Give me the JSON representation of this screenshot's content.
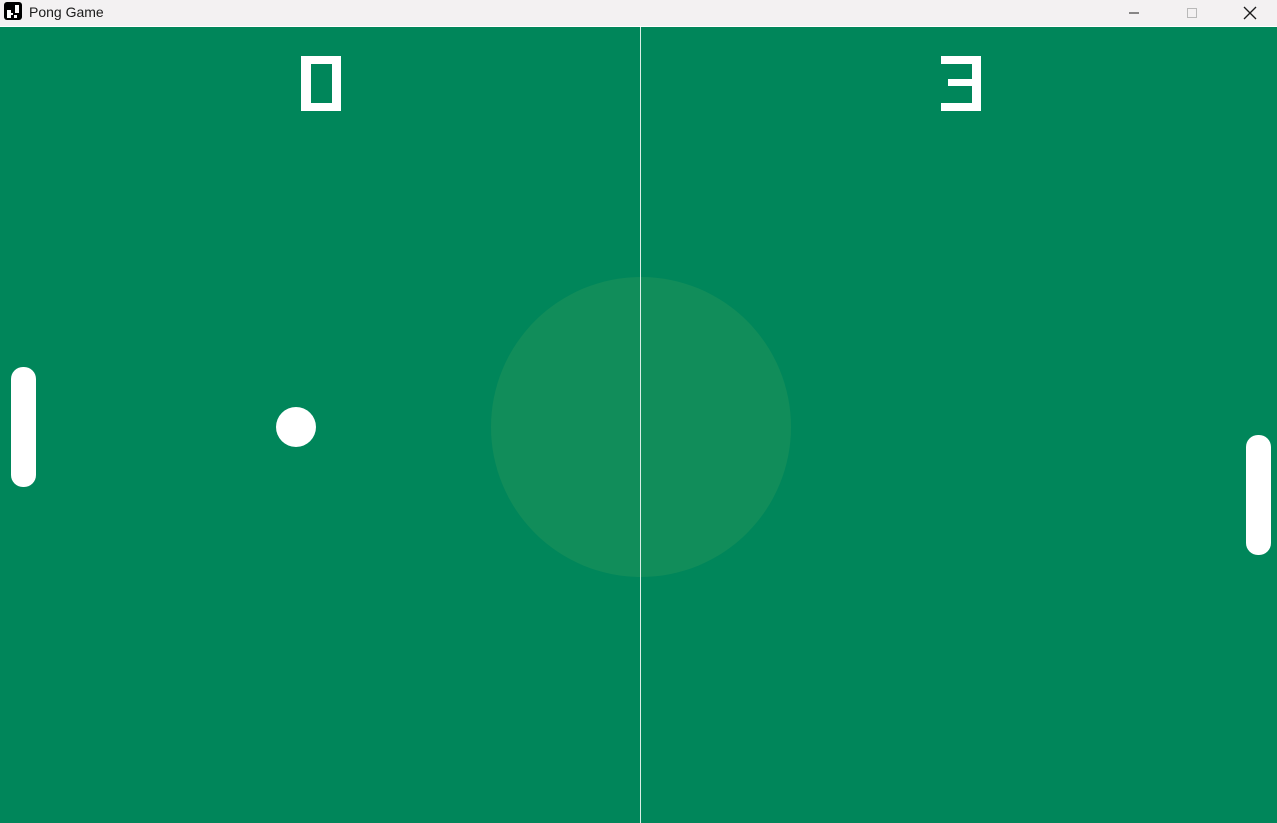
{
  "window": {
    "title": "Pong Game",
    "app_icon": "app-icon",
    "controls": {
      "minimize_icon": "minimize-icon",
      "maximize_icon": "maximize-icon",
      "close_icon": "close-icon"
    }
  },
  "game": {
    "score_left": "0",
    "score_right": "3",
    "colors": {
      "field": "#00865a",
      "center_circle": "#118d5a",
      "center_line": "#d8efe5",
      "paddles_ball": "#ffffff",
      "titlebar": "#f3f1f2"
    }
  }
}
